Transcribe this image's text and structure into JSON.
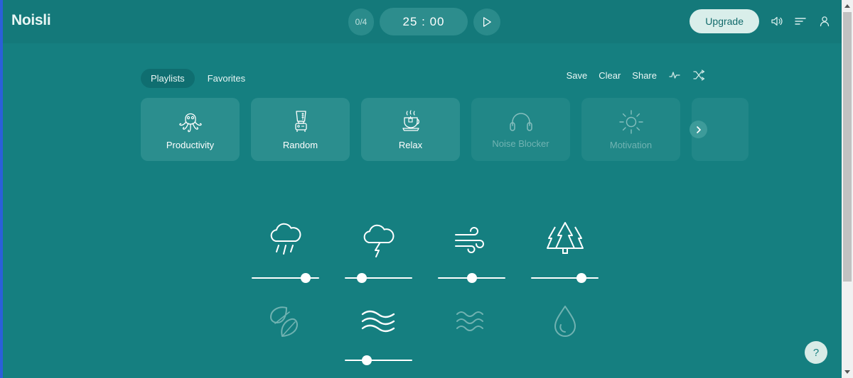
{
  "app": {
    "logo": "Noisli",
    "background_color": "#157f80",
    "card_color": "#2b8e8e",
    "accent_light": "#d9eeea"
  },
  "header": {
    "timer": {
      "pomodoro_count": "0/4",
      "time_display": "25 : 00",
      "play_icon": "play-icon"
    },
    "upgrade_label": "Upgrade",
    "icons": [
      {
        "name": "volume-icon"
      },
      {
        "name": "mixer-icon"
      },
      {
        "name": "account-icon"
      }
    ]
  },
  "toolbar": {
    "tabs": [
      {
        "label": "Playlists",
        "active": true
      },
      {
        "label": "Favorites",
        "active": false
      }
    ],
    "actions": [
      {
        "label": "Save"
      },
      {
        "label": "Clear"
      },
      {
        "label": "Share"
      }
    ],
    "icon_actions": [
      {
        "name": "waveform-icon"
      },
      {
        "name": "shuffle-icon"
      }
    ]
  },
  "playlists": {
    "items": [
      {
        "label": "Productivity",
        "icon": "octopus-icon",
        "dimmed": false
      },
      {
        "label": "Random",
        "icon": "blender-icon",
        "dimmed": false
      },
      {
        "label": "Relax",
        "icon": "teacup-icon",
        "dimmed": false
      },
      {
        "label": "Noise Blocker",
        "icon": "headphones-icon",
        "dimmed": true
      },
      {
        "label": "Motivation",
        "icon": "sun-icon",
        "dimmed": true
      }
    ],
    "next_icon": "chevron-right-icon"
  },
  "sounds": [
    {
      "name": "rain-sound",
      "icon": "rain-cloud-icon",
      "active": true,
      "volume": 80
    },
    {
      "name": "thunder-sound",
      "icon": "thunder-cloud-icon",
      "active": true,
      "volume": 25
    },
    {
      "name": "wind-sound",
      "icon": "wind-icon",
      "active": true,
      "volume": 50
    },
    {
      "name": "forest-sound",
      "icon": "forest-trees-icon",
      "active": true,
      "volume": 75
    },
    {
      "name": "leaves-sound",
      "icon": "leaves-icon",
      "active": false,
      "volume": 0
    },
    {
      "name": "water-stream-sound",
      "icon": "water-waves-icon",
      "active": true,
      "volume": 33
    },
    {
      "name": "sea-sound",
      "icon": "sea-waves-icon",
      "active": false,
      "volume": 0
    },
    {
      "name": "water-drop-sound",
      "icon": "water-drop-icon",
      "active": false,
      "volume": 0
    }
  ],
  "help": {
    "label": "?"
  }
}
